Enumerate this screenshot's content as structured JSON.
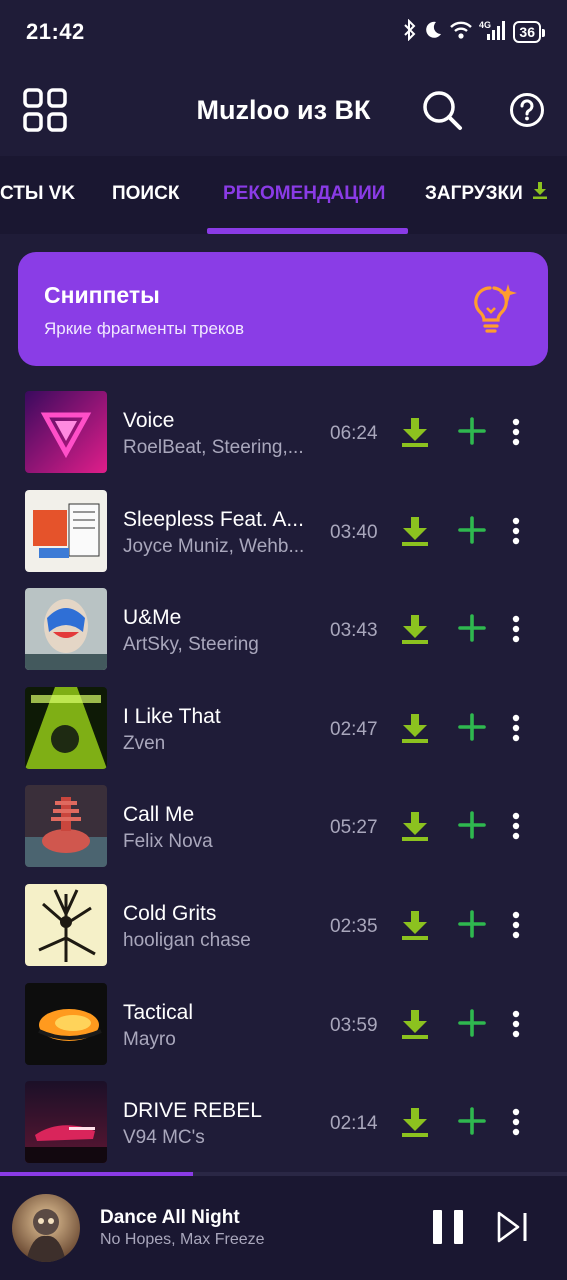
{
  "status": {
    "time": "21:42",
    "network": "4G",
    "battery": "36"
  },
  "header": {
    "title": "Muzloo из ВК"
  },
  "tabs": [
    {
      "label": "СТЫ VK"
    },
    {
      "label": "ПОИСК"
    },
    {
      "label": "РЕКОМЕНДАЦИИ"
    },
    {
      "label": "ЗАГРУЗКИ"
    }
  ],
  "active_tab": "РЕКОМЕНДАЦИИ",
  "snippets": {
    "title": "Сниппеты",
    "subtitle": "Яркие фрагменты треков"
  },
  "tracks": [
    {
      "title": "Voice",
      "artist": "RoelBeat, Steering,...",
      "duration": "06:24"
    },
    {
      "title": "Sleepless Feat. A...",
      "artist": "Joyce Muniz, Wehb...",
      "duration": "03:40"
    },
    {
      "title": "U&Me",
      "artist": "ArtSky, Steering",
      "duration": "03:43"
    },
    {
      "title": "I Like That",
      "artist": "Zven",
      "duration": "02:47"
    },
    {
      "title": "Call Me",
      "artist": "Felix Nova",
      "duration": "05:27"
    },
    {
      "title": "Cold Grits",
      "artist": "hooligan chase",
      "duration": "02:35"
    },
    {
      "title": "Tactical",
      "artist": "Mayro",
      "duration": "03:59"
    },
    {
      "title": "DRIVE REBEL",
      "artist": "V94 MC's",
      "duration": "02:14"
    }
  ],
  "player": {
    "title": "Dance All Night",
    "artist": "No Hopes, Max Freeze",
    "progress": 0.34
  },
  "colors": {
    "background": "#1f1c38",
    "accent": "#8a3be6",
    "download": "#8cc21f",
    "add": "#2fb84f",
    "secondary_text": "#a9a7bc"
  }
}
